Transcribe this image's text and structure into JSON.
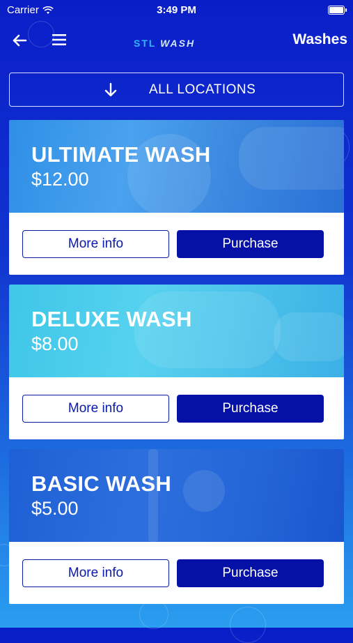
{
  "status_bar": {
    "carrier": "Carrier",
    "time": "3:49 PM"
  },
  "nav": {
    "logo_stl": "STL",
    "logo_wash": "WASH",
    "title": "Washes"
  },
  "locations": {
    "label": "ALL LOCATIONS"
  },
  "washes": [
    {
      "name": "ULTIMATE WASH",
      "price": "$12.00",
      "more_info": "More info",
      "purchase": "Purchase"
    },
    {
      "name": "DELUXE WASH",
      "price": "$8.00",
      "more_info": "More info",
      "purchase": "Purchase"
    },
    {
      "name": "BASIC WASH",
      "price": "$5.00",
      "more_info": "More info",
      "purchase": "Purchase"
    }
  ],
  "colors": {
    "primary": "#0511a6",
    "background_top": "#0a1ec8",
    "background_bottom": "#2a9ef0"
  }
}
